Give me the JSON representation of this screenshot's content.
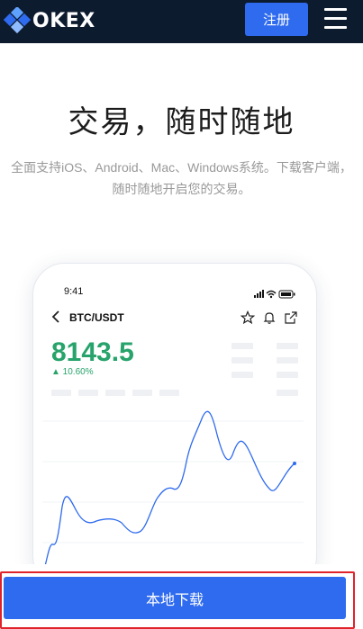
{
  "header": {
    "logo_text": "OKEX",
    "signup_label": "注册"
  },
  "hero": {
    "title": "交易，随时随地",
    "subtitle": "全面支持iOS、Android、Mac、Windows系统。下载客户端，随时随地开启您的交易。"
  },
  "phone": {
    "time": "9:41",
    "pair": "BTC/USDT",
    "price": "8143.5",
    "change": "▲ 10.60%"
  },
  "download": {
    "label": "本地下载"
  },
  "colors": {
    "header_bg": "#0d1b2f",
    "accent": "#2f6bef",
    "price_green": "#27a36b",
    "highlight_red": "#e0232b"
  },
  "icons": [
    "okex-logo-icon",
    "menu-icon",
    "back-chevron-icon",
    "star-icon",
    "bell-icon",
    "share-icon",
    "signal-icon",
    "wifi-icon",
    "battery-icon"
  ]
}
